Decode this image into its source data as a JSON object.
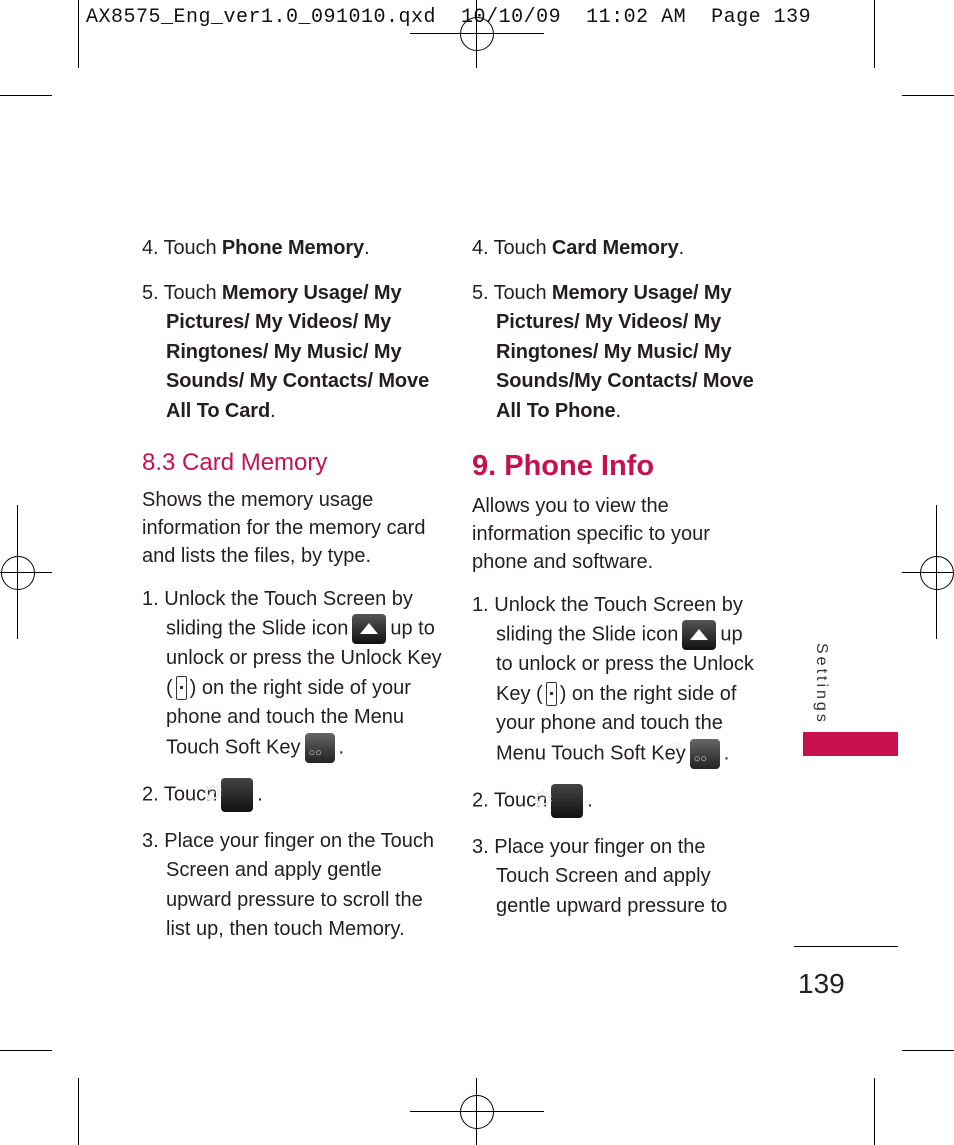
{
  "print_header": "AX8575_Eng_ver1.0_091010.qxd  10/10/09  11:02 AM  Page 139",
  "colors": {
    "accent": "#c8104e",
    "text": "#231f20"
  },
  "left_column": {
    "step4": {
      "num": "4.",
      "pre": "Touch ",
      "bold": "Phone Memory",
      "post": "."
    },
    "step5": {
      "num": "5.",
      "pre": "Touch ",
      "bold": "Memory Usage/ My Pictures/ My Videos/ My Ringtones/ My Music/ My Sounds/ My Contacts/ Move All To Card",
      "post": "."
    },
    "section_heading": "8.3 Card Memory",
    "intro": "Shows the memory usage information for the memory card and lists the files, by type.",
    "steps": [
      {
        "num": "1.",
        "a": "Unlock the Touch Screen by sliding the Slide icon",
        "b": "up to unlock or press the Unlock Key (",
        "c": ") on the right side of your phone and touch the Menu Touch Soft Key",
        "d": "."
      },
      {
        "num": "2.",
        "a": "Touch",
        "b": "."
      },
      {
        "num": "3.",
        "a": "Place your finger on the Touch Screen and apply gentle upward pressure to scroll the list up, then touch Memory."
      }
    ]
  },
  "right_column": {
    "step4": {
      "num": "4.",
      "pre": "Touch ",
      "bold": "Card Memory",
      "post": "."
    },
    "step5": {
      "num": "5.",
      "pre": "Touch ",
      "bold": "Memory Usage/ My Pictures/ My Videos/ My Ringtones/ My Music/ My Sounds/My Contacts/ Move All To Phone",
      "post": "."
    },
    "section_heading": "9. Phone Info",
    "intro": "Allows you to view the information specific to your phone and software.",
    "steps": [
      {
        "num": "1.",
        "a": "Unlock the Touch Screen by sliding the Slide icon",
        "b": "up to unlock or press the Unlock Key (",
        "c": ") on the right side of your phone and touch the Menu Touch Soft Key",
        "d": "."
      },
      {
        "num": "2.",
        "a": "Touch",
        "b": "."
      },
      {
        "num": "3.",
        "a": "Place your finger on the Touch Screen and apply gentle upward pressure to"
      }
    ]
  },
  "side_tab_label": "Settings",
  "page_number": "139",
  "icons": [
    "slide-up-icon",
    "unlock-key-icon",
    "menu-soft-key-icon",
    "settings-gear-icon"
  ]
}
